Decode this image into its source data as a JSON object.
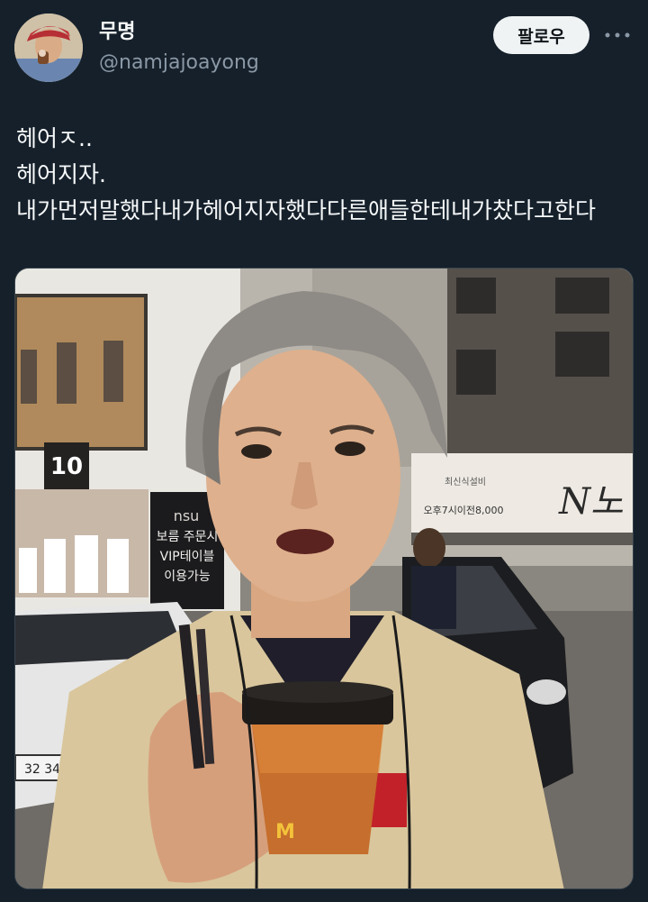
{
  "author": {
    "display_name": "무명",
    "handle": "@namjajoayong",
    "avatar_icon": "profile-avatar"
  },
  "actions": {
    "follow_label": "팔로우",
    "more_icon": "more-dots-icon"
  },
  "tweet": {
    "text": "헤어ㅈ..\n헤어지자.내가먼저말했다내가헤어지자했다다른애들한테내가찼다고한다"
  },
  "media": {
    "signs": {
      "sign_10": "10",
      "sign_nsu": "nsu",
      "sign_order": "보름 주문시",
      "sign_vip": "VIP테이블",
      "sign_use": "이용가능",
      "sign_shop_small": "최신식설비",
      "sign_shop_hours": "오후7시이전8,000",
      "sign_shop_big": "N노",
      "plate": "32 34",
      "cup_logo": "M"
    },
    "colors": {
      "background": "#15202b",
      "hair": "#8e8a86",
      "shirt": "#d6c49a",
      "cup": "#c56e2d",
      "lid": "#1e1b19"
    }
  }
}
